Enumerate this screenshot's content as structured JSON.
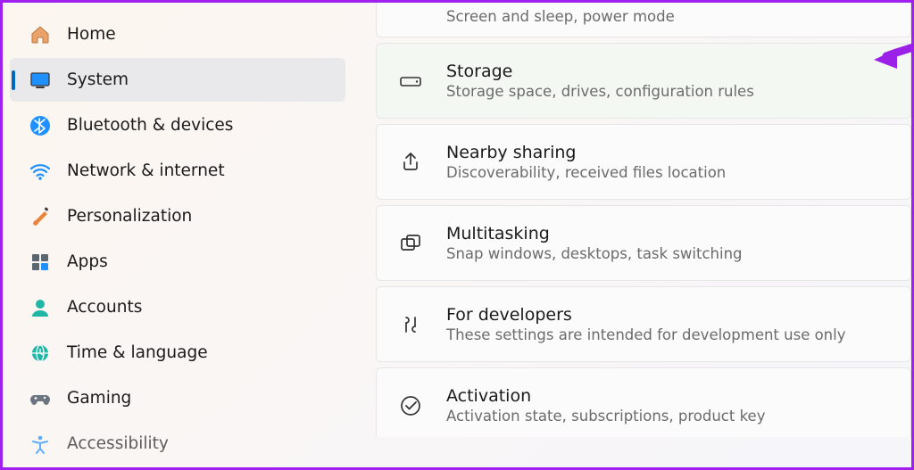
{
  "sidebar": {
    "items": [
      {
        "label": "Home",
        "icon": "home-icon"
      },
      {
        "label": "System",
        "icon": "system-icon",
        "selected": true
      },
      {
        "label": "Bluetooth & devices",
        "icon": "bluetooth-icon"
      },
      {
        "label": "Network & internet",
        "icon": "network-icon"
      },
      {
        "label": "Personalization",
        "icon": "personalization-icon"
      },
      {
        "label": "Apps",
        "icon": "apps-icon"
      },
      {
        "label": "Accounts",
        "icon": "accounts-icon"
      },
      {
        "label": "Time & language",
        "icon": "time-language-icon"
      },
      {
        "label": "Gaming",
        "icon": "gaming-icon"
      },
      {
        "label": "Accessibility",
        "icon": "accessibility-icon"
      }
    ]
  },
  "main": {
    "cards": [
      {
        "title": "",
        "sub": "Screen and sleep, power mode",
        "icon": "",
        "partial_top": true
      },
      {
        "title": "Storage",
        "sub": "Storage space, drives, configuration rules",
        "icon": "storage-icon",
        "highlight": true
      },
      {
        "title": "Nearby sharing",
        "sub": "Discoverability, received files location",
        "icon": "share-icon"
      },
      {
        "title": "Multitasking",
        "sub": "Snap windows, desktops, task switching",
        "icon": "multitask-icon"
      },
      {
        "title": "For developers",
        "sub": "These settings are intended for development use only",
        "icon": "developer-icon"
      },
      {
        "title": "Activation",
        "sub": "Activation state, subscriptions, product key",
        "icon": "activation-icon",
        "partial_bottom": true
      }
    ]
  },
  "annotation": {
    "color": "#9b20e8"
  }
}
